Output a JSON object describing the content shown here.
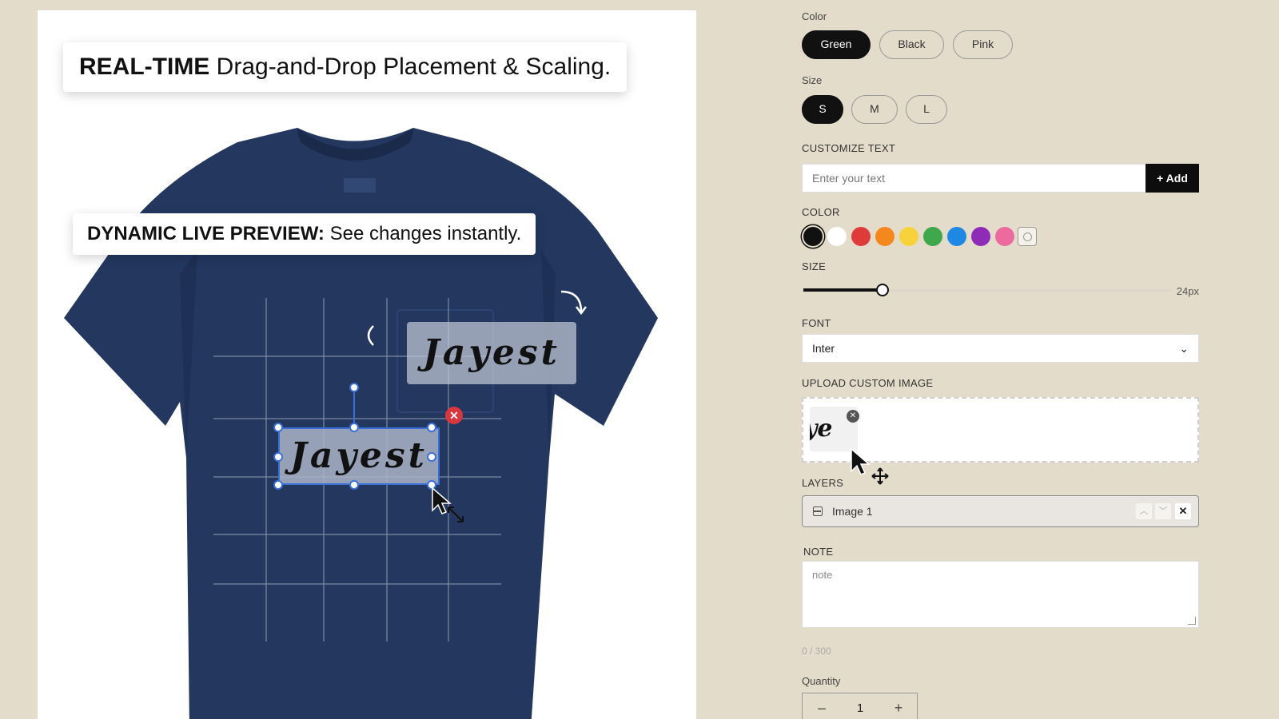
{
  "preview": {
    "banner_top_bold": "REAL-TIME",
    "banner_top_rest": "Drag-and-Drop Placement & Scaling.",
    "banner_mid_bold": "DYNAMIC LIVE PREVIEW:",
    "banner_mid_rest": "See changes instantly.",
    "ghost_text": "Jayest",
    "selected_text": "Jayest",
    "shirt_color": "#23375f"
  },
  "options": {
    "color_label": "Color",
    "colors": [
      "Green",
      "Black",
      "Pink"
    ],
    "selected_color": "Green",
    "size_label": "Size",
    "sizes": [
      "S",
      "M",
      "L"
    ],
    "selected_size": "S"
  },
  "customize_text": {
    "label": "CUSTOMIZE TEXT",
    "placeholder": "Enter your text",
    "add_label": "+ Add"
  },
  "text_color": {
    "label": "COLOR",
    "swatches": [
      "#111111",
      "#ffffff",
      "#e03b3b",
      "#f5871f",
      "#f7d23b",
      "#3ea84a",
      "#1f88e5",
      "#8e2cb8",
      "#ec6a9e"
    ],
    "selected": "#111111",
    "picker_icon": "color-picker-icon"
  },
  "text_size": {
    "label": "SIZE",
    "value_label": "24px",
    "value": 24
  },
  "font": {
    "label": "FONT",
    "selected": "Inter"
  },
  "upload": {
    "label": "UPLOAD CUSTOM IMAGE",
    "thumb_text": "ye"
  },
  "layers": {
    "label": "LAYERS",
    "items": [
      {
        "name": "Image 1"
      }
    ]
  },
  "note": {
    "label": "NOTE",
    "placeholder": "note",
    "char_count": "0 / 300"
  },
  "quantity": {
    "label": "Quantity",
    "value": "1",
    "minus": "–",
    "plus": "+"
  }
}
